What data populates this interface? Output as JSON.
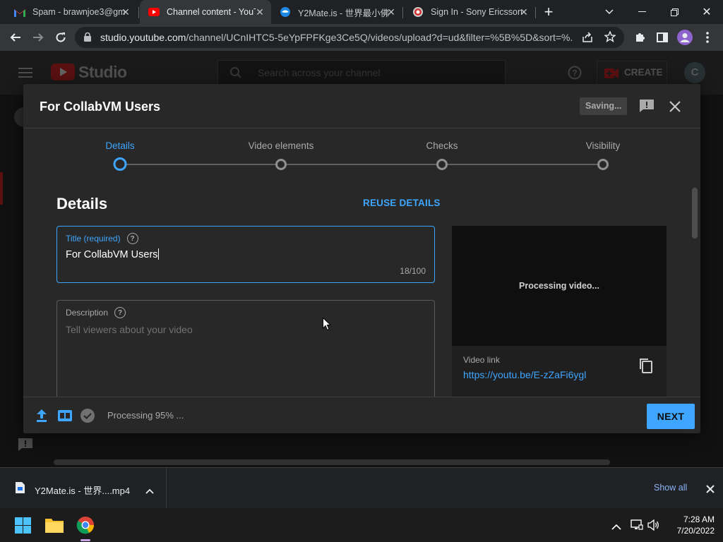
{
  "browser": {
    "tabs": [
      {
        "title": "Spam - brawnjoe3@gm",
        "icon": "gmail-icon"
      },
      {
        "title": "Channel content - YouT",
        "icon": "youtube-icon",
        "active": true
      },
      {
        "title": "Y2Mate.is - 世界最小佛",
        "icon": "y2mate-icon"
      },
      {
        "title": "Sign In - Sony Ericsson",
        "icon": "sony-ericsson-icon"
      }
    ],
    "url_host": "studio.youtube.com",
    "url_path": "/channel/UCnIHTC5-5eYpFPFKge3Ce5Q/videos/upload?d=ud&filter=%5B%5D&sort=%..."
  },
  "studio": {
    "logo_text": "Studio",
    "search_placeholder": "Search across your channel",
    "create_label": "CREATE",
    "avatar_letter": "C"
  },
  "dialog": {
    "title": "For CollabVM Users",
    "saving_label": "Saving...",
    "steps": [
      "Details",
      "Video elements",
      "Checks",
      "Visibility"
    ],
    "active_step": 0,
    "section_heading": "Details",
    "reuse_label": "REUSE DETAILS",
    "title_field": {
      "label": "Title (required)",
      "value": "For CollabVM Users",
      "count": "18/100"
    },
    "description_field": {
      "label": "Description",
      "placeholder": "Tell viewers about your video"
    },
    "preview": {
      "processing_text": "Processing video...",
      "link_label": "Video link",
      "link_url": "https://youtu.be/E-zZaFi6ygl"
    },
    "footer": {
      "status_text": "Processing 95% ...",
      "next_label": "NEXT"
    }
  },
  "download_shelf": {
    "file_name": "Y2Mate.is - 世界....mp4",
    "show_all_label": "Show all"
  },
  "taskbar": {
    "time": "7:28 AM",
    "date": "7/20/2022"
  }
}
